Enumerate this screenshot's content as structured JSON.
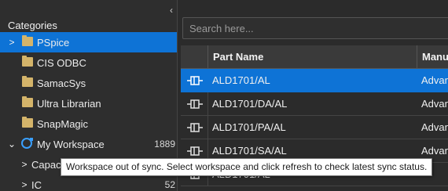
{
  "left_panel": {
    "collapse_icon": "chevron-left",
    "title": "Categories",
    "items": [
      {
        "label": "PSpice",
        "icon": "folder",
        "expand": ">"
      },
      {
        "label": "CIS ODBC",
        "icon": "folder"
      },
      {
        "label": "SamacSys",
        "icon": "folder"
      },
      {
        "label": "Ultra Librarian",
        "icon": "folder"
      },
      {
        "label": "SnapMagic",
        "icon": "folder"
      },
      {
        "label": "My Workspace",
        "icon": "sync",
        "expand": "⌄",
        "count": "1889"
      }
    ],
    "sub_items": [
      {
        "label": "Capac",
        "expand": ">"
      },
      {
        "label": "IC",
        "expand": ">",
        "count": "52"
      }
    ]
  },
  "search": {
    "placeholder": "Search here..."
  },
  "grid": {
    "headers": [
      "Part Name",
      "Manu"
    ],
    "rows": [
      {
        "part_name": "ALD1701/AL",
        "manufacturer": "Advan"
      },
      {
        "part_name": "ALD1701/DA/AL",
        "manufacturer": "Advan"
      },
      {
        "part_name": "ALD1701/PA/AL",
        "manufacturer": "Advan"
      },
      {
        "part_name": "ALD1701/SA/AL",
        "manufacturer": "Advan"
      },
      {
        "part_name": "ALD1701/AL",
        "manufacturer": ""
      }
    ]
  },
  "tooltip": {
    "text": "Workspace out of sync. Select workspace and click refresh to check latest sync status."
  },
  "colors": {
    "selection": "#0e73d6",
    "background": "#2b2b2b",
    "folder": "#d4b46a",
    "sync": "#3aa0ff"
  }
}
